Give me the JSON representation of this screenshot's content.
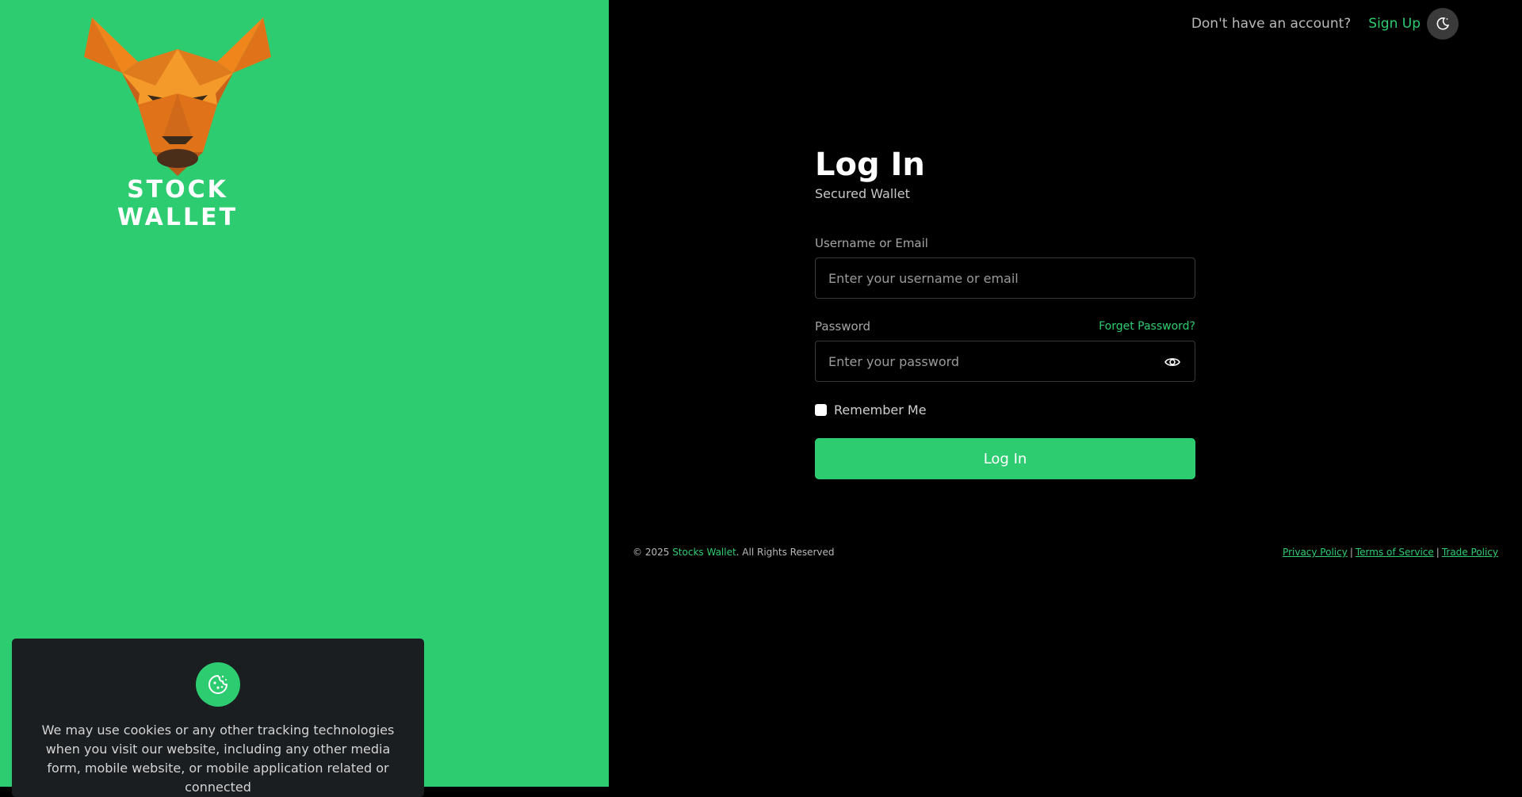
{
  "brand": {
    "name": "STOCK WALLET",
    "accent_color": "#2ecc71",
    "logo_icon": "bull-head-logo"
  },
  "topbar": {
    "question": "Don't have an account?",
    "signup_label": "Sign Up",
    "theme_icon": "moon-icon"
  },
  "form": {
    "title": "Log In",
    "subtitle": "Secured Wallet",
    "username_label": "Username or Email",
    "username_placeholder": "Enter your username or email",
    "password_label": "Password",
    "forgot_label": "Forget Password?",
    "password_placeholder": "Enter your password",
    "remember_label": "Remember Me",
    "submit_label": "Log In"
  },
  "footer": {
    "copyright_prefix": "© 2025",
    "company": "Stocks Wallet",
    "rights": ". All Rights Reserved",
    "links": [
      "Privacy Policy",
      "Terms of Service",
      "Trade Policy"
    ],
    "separator": "|"
  },
  "cookie": {
    "icon": "cookie-icon",
    "text": "We may use cookies or any other tracking technologies when you visit our website, including any other media form, mobile website, or mobile application related or connected"
  }
}
